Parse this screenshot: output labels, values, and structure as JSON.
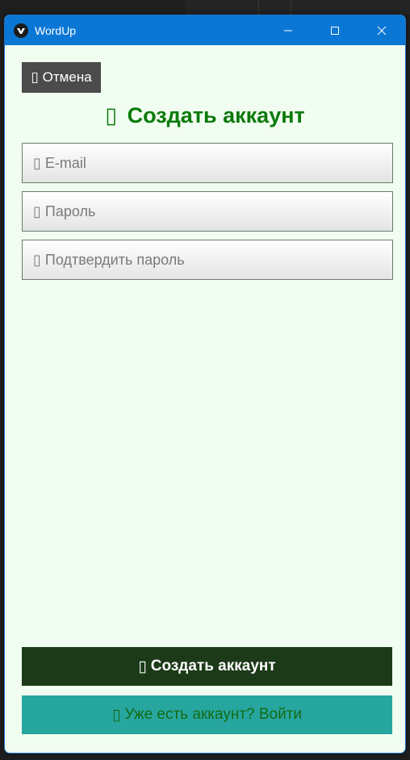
{
  "window": {
    "title": "WordUp"
  },
  "icons": {
    "app": "app-logo-icon",
    "minimize": "minimize-icon",
    "maximize": "maximize-icon",
    "close": "close-icon",
    "missing_glyph": "missing-glyph-icon"
  },
  "form": {
    "cancel_label": "Отмена",
    "heading": "Создать аккаунт",
    "email_placeholder": "E-mail",
    "password_placeholder": "Пароль",
    "confirm_placeholder": "Подтвердить пароль",
    "create_label": "Создать аккаунт",
    "login_label": "Уже есть аккаунт? Войти"
  },
  "colors": {
    "titlebar": "#0a77d5",
    "background": "#f0fdf0",
    "heading": "#0b7a0b",
    "create_button": "#1c3a18",
    "login_button": "#27a6a0",
    "cancel_button": "#4b4b4b"
  }
}
